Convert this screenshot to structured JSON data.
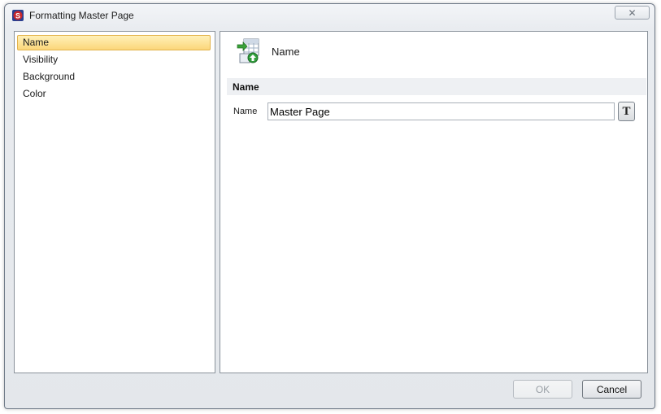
{
  "window": {
    "title": "Formatting Master Page",
    "close_glyph": "✕",
    "icon": "app-icon"
  },
  "nav": {
    "items": [
      {
        "label": "Name",
        "selected": true
      },
      {
        "label": "Visibility",
        "selected": false
      },
      {
        "label": "Background",
        "selected": false
      },
      {
        "label": "Color",
        "selected": false
      }
    ]
  },
  "panel": {
    "header_icon": "page-name-icon",
    "header_title": "Name",
    "section_title": "Name",
    "field_label": "Name",
    "field_value": "Master Page",
    "text_format_button": "T"
  },
  "footer": {
    "ok_label": "OK",
    "ok_enabled": false,
    "cancel_label": "Cancel"
  },
  "colors": {
    "selection_fill": "#fbd67a",
    "selection_border": "#e3b34c",
    "app_icon_red": "#c8262b",
    "app_icon_blue": "#2b3f8f"
  }
}
